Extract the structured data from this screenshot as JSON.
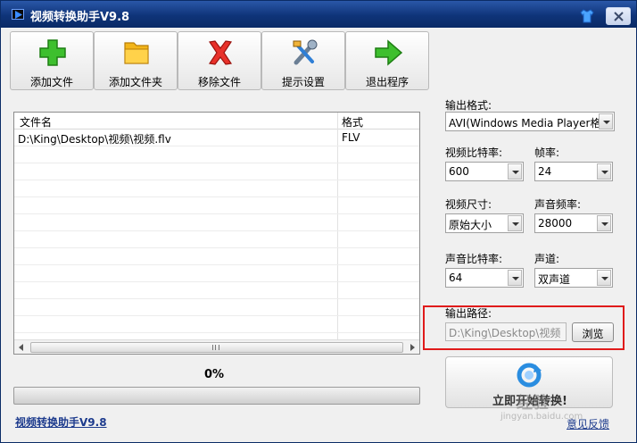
{
  "window": {
    "title": "视频转换助手V9.8"
  },
  "toolbar": {
    "buttons": [
      {
        "label": "添加文件",
        "icon": "plus-icon"
      },
      {
        "label": "添加文件夹",
        "icon": "folder-icon"
      },
      {
        "label": "移除文件",
        "icon": "delete-x-icon"
      },
      {
        "label": "提示设置",
        "icon": "tools-icon"
      },
      {
        "label": "退出程序",
        "icon": "exit-arrow-icon"
      }
    ]
  },
  "file_list": {
    "columns": [
      "文件名",
      "格式"
    ],
    "rows": [
      {
        "name": "D:\\King\\Desktop\\视频\\视频.flv",
        "format": "FLV"
      }
    ]
  },
  "progress": {
    "text": "0%",
    "value": 0
  },
  "footer": {
    "link": "视频转换助手V9.8",
    "feedback": "意见反馈"
  },
  "settings": {
    "output_format_label": "输出格式:",
    "output_format_value": "AVI(Windows Media Player格式)",
    "video_bitrate_label": "视频比特率:",
    "video_bitrate_value": "600",
    "framerate_label": "帧率:",
    "framerate_value": "24",
    "video_size_label": "视频尺寸:",
    "video_size_value": "原始大小",
    "audio_freq_label": "声音频率:",
    "audio_freq_value": "28000",
    "audio_bitrate_label": "声音比特率:",
    "audio_bitrate_value": "64",
    "channel_label": "声道:",
    "channel_value": "双声道",
    "output_path_label": "输出路径:",
    "output_path_value": "D:\\King\\Desktop\\视频",
    "browse_label": "浏览"
  },
  "start_button": {
    "label": "立即开始转换!"
  },
  "watermark": {
    "text": "经验",
    "sub": "jingyan.baidu.com"
  },
  "colors": {
    "titlebar": "#0f3479",
    "highlight_box": "#e01b1b",
    "link": "#1d3b8d"
  }
}
